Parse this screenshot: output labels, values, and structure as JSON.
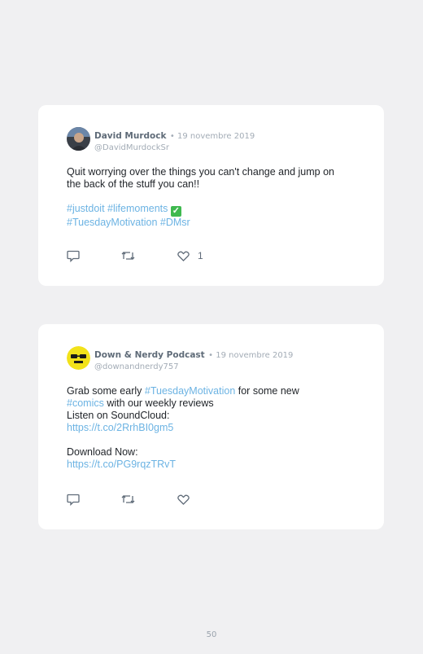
{
  "tweets": [
    {
      "author": "David Murdock",
      "date": "• 19 novembre 2019",
      "handle": "@DavidMurdockSr",
      "text_lines": [
        "Quit worrying over the things you can't change and jump on",
        "the back of the stuff you can!!"
      ],
      "hashtags_line1": [
        "#justdoit",
        "#lifemoments"
      ],
      "hashtags_line2": [
        "#TuesdayMotivation",
        "#DMsr"
      ],
      "like_count": "1",
      "icons": {
        "reply": "reply-icon",
        "retweet": "retweet-icon",
        "like": "heart-icon",
        "check": "check-mark-icon"
      }
    },
    {
      "author": "Down & Nerdy Podcast",
      "date": "• 19 novembre 2019",
      "handle": "@downandnerdy757",
      "line1_prefix": "Grab some early ",
      "line1_tag": "#TuesdayMotivation",
      "line1_suffix": " for some new",
      "line2_tag": "#comics",
      "line2_suffix": " with our weekly reviews",
      "line3": "Listen on SoundCloud:",
      "link1": "https://t.co/2RrhBI0gm5",
      "line5": "Download Now:",
      "link2": "https://t.co/PG9rqzTRvT",
      "avatar_color": "#f2e21a"
    }
  ],
  "colors": {
    "hashtag": "#6cb3e3",
    "text": "#1f2328",
    "muted": "#a3acb6"
  },
  "page_number": "50"
}
